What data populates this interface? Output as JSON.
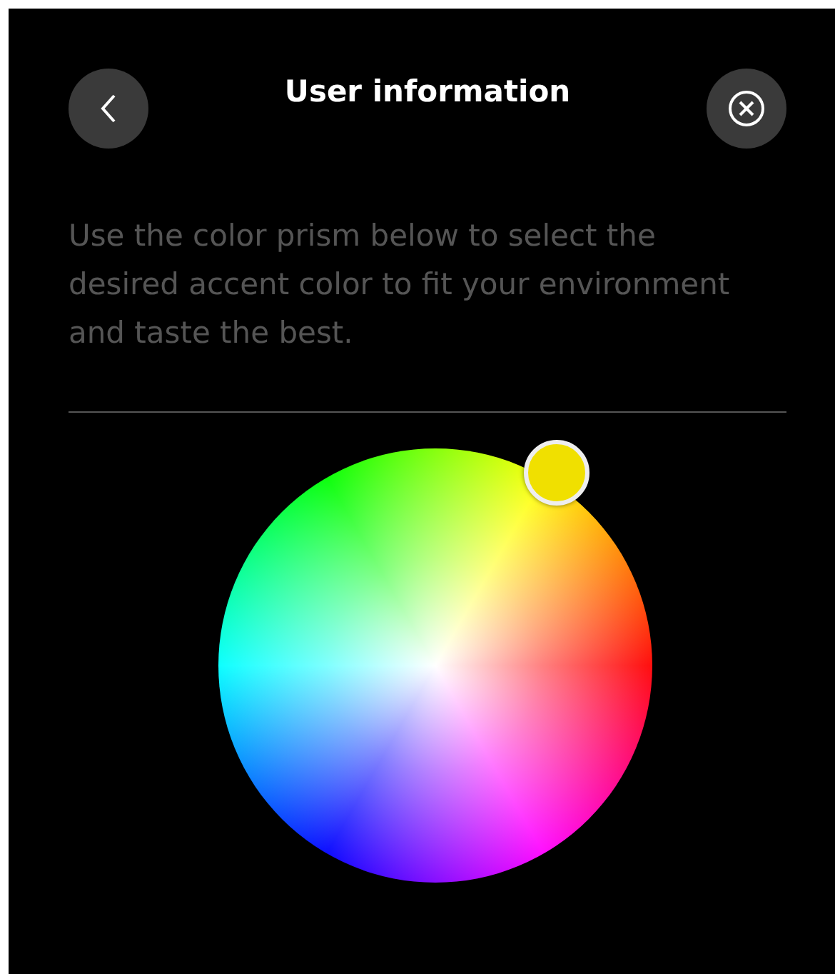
{
  "header": {
    "title": "User information"
  },
  "description": "Use the color prism below to select the desired accent color to fit your environment and taste the best.",
  "color_picker": {
    "color": "#f0e000"
  }
}
